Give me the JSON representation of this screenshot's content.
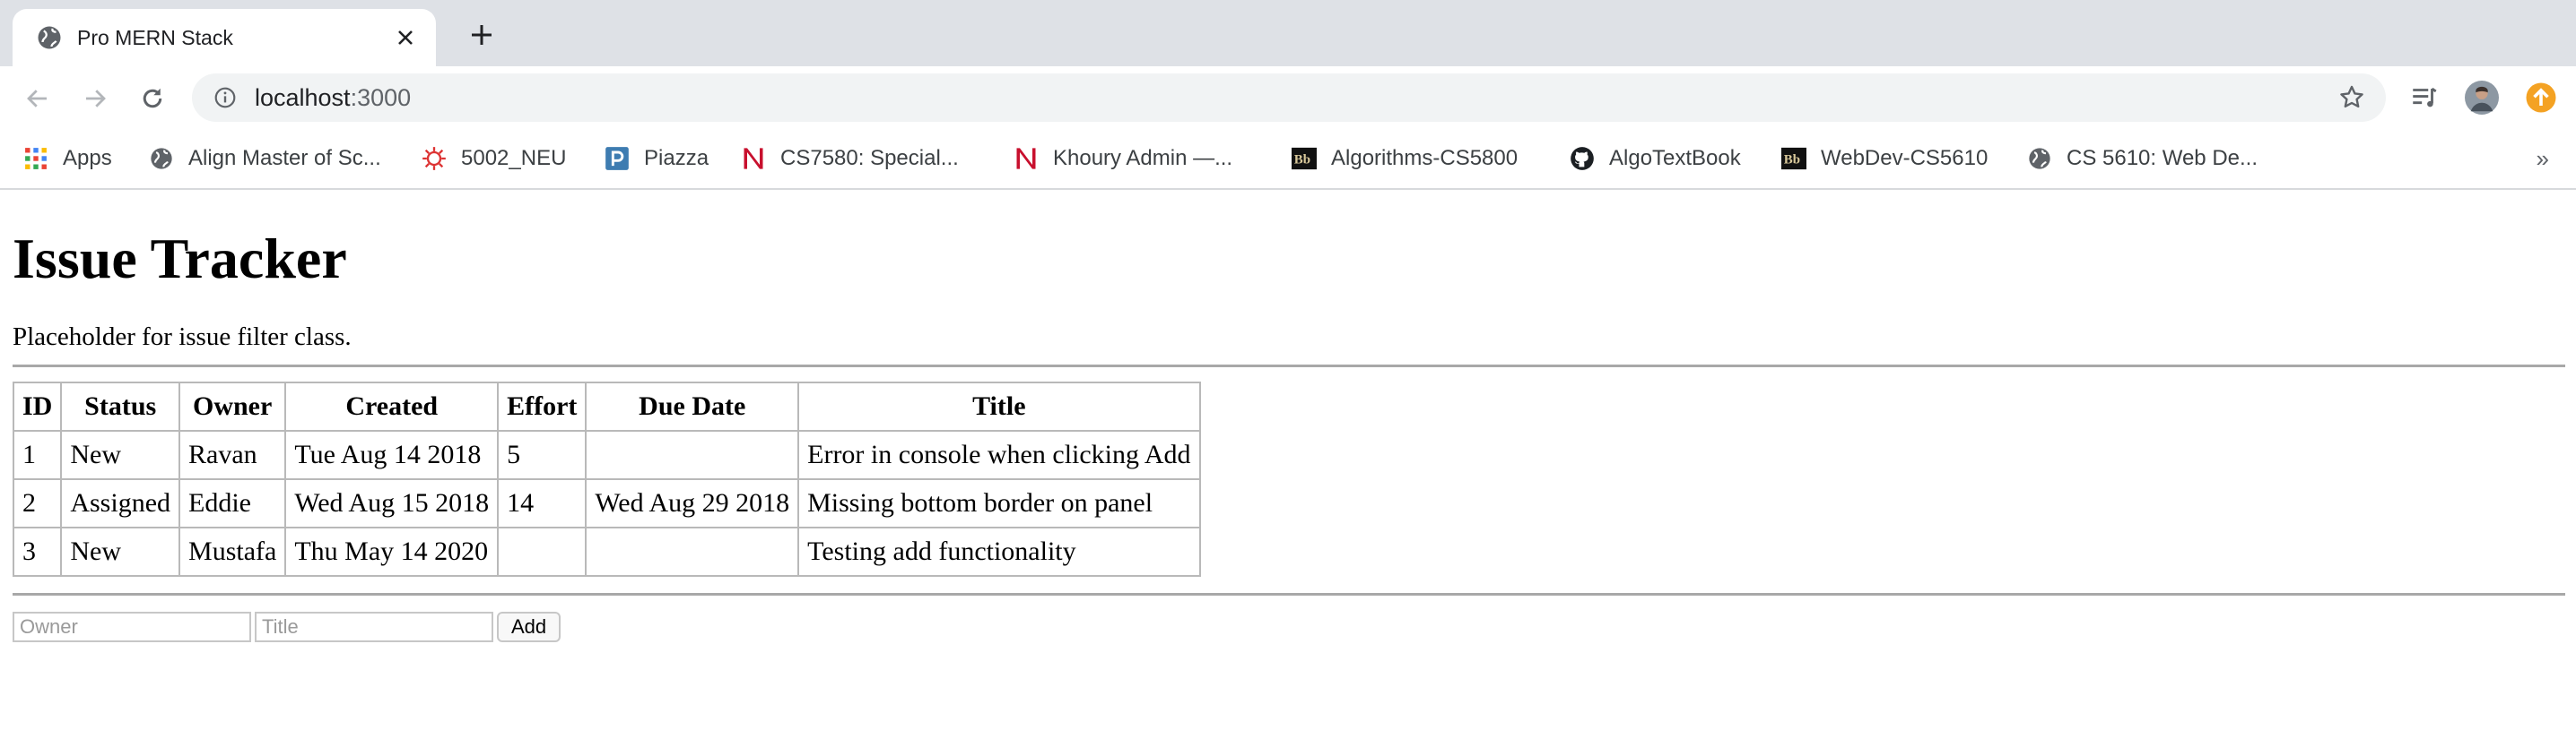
{
  "browser": {
    "tab_title": "Pro MERN Stack",
    "url_host": "localhost",
    "url_port": ":3000",
    "bookmarks": [
      {
        "label": "Apps",
        "icon": "apps-grid-icon"
      },
      {
        "label": "Align Master of Sc...",
        "icon": "globe-icon"
      },
      {
        "label": "5002_NEU",
        "icon": "red-sun-icon"
      },
      {
        "label": "Piazza",
        "icon": "piazza-icon"
      },
      {
        "label": "CS7580: Special...",
        "icon": "northeastern-n-icon"
      },
      {
        "label": "Khoury Admin —...",
        "icon": "northeastern-n-icon"
      },
      {
        "label": "Algorithms-CS5800",
        "icon": "blackboard-icon"
      },
      {
        "label": "AlgoTextBook",
        "icon": "github-icon"
      },
      {
        "label": "WebDev-CS5610",
        "icon": "blackboard-icon"
      },
      {
        "label": "CS 5610: Web De...",
        "icon": "globe-icon"
      }
    ],
    "more_label": "»"
  },
  "page": {
    "title": "Issue Tracker",
    "filter_placeholder": "Placeholder for issue filter class.",
    "table": {
      "headers": [
        "ID",
        "Status",
        "Owner",
        "Created",
        "Effort",
        "Due Date",
        "Title"
      ],
      "rows": [
        [
          "1",
          "New",
          "Ravan",
          "Tue Aug 14 2018",
          "5",
          "",
          "Error in console when clicking Add"
        ],
        [
          "2",
          "Assigned",
          "Eddie",
          "Wed Aug 15 2018",
          "14",
          "Wed Aug 29 2018",
          "Missing bottom border on panel"
        ],
        [
          "3",
          "New",
          "Mustafa",
          "Thu May 14 2020",
          "",
          "",
          "Testing add functionality"
        ]
      ]
    },
    "add_form": {
      "owner_placeholder": "Owner",
      "title_placeholder": "Title",
      "add_label": "Add"
    }
  }
}
